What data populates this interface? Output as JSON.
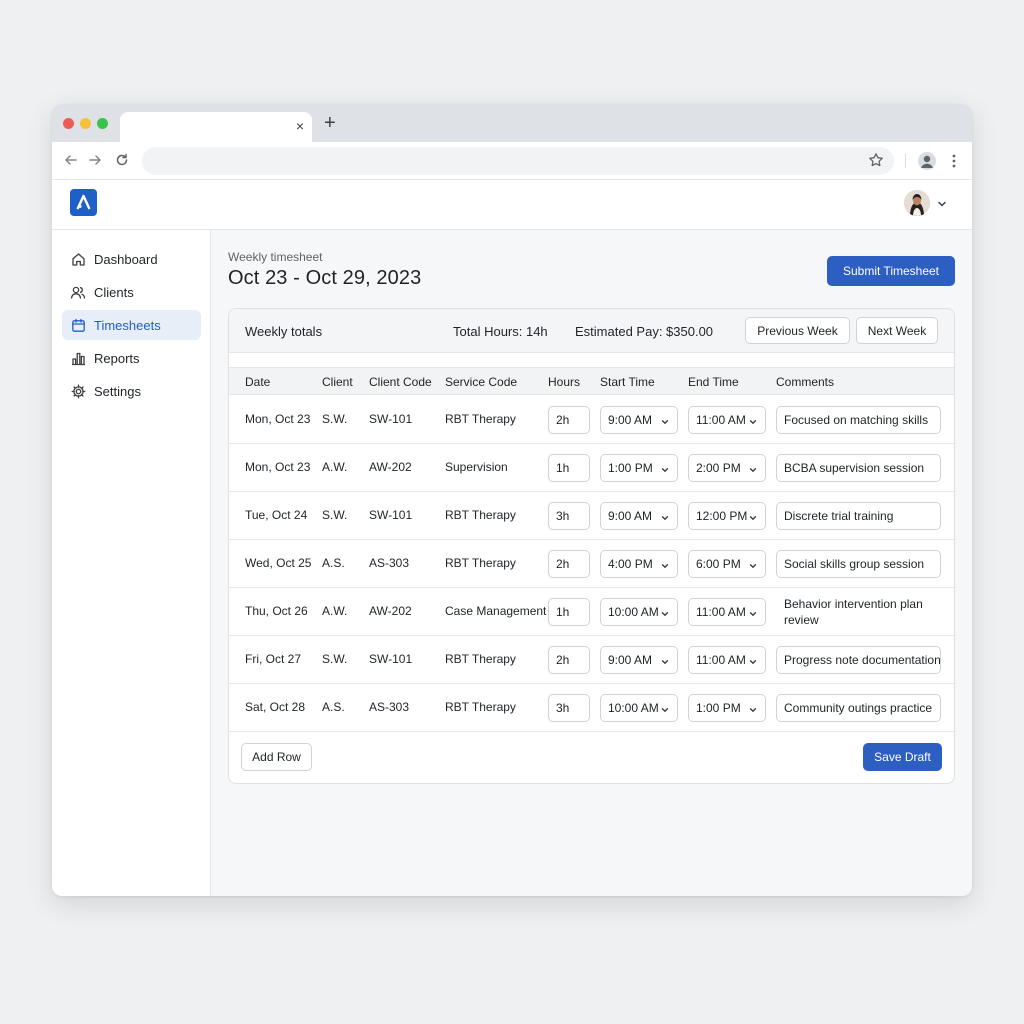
{
  "browser": {
    "tab_close": "×",
    "new_tab": "+"
  },
  "sidebar": {
    "items": [
      {
        "label": "Dashboard",
        "icon": "home-icon"
      },
      {
        "label": "Clients",
        "icon": "users-icon"
      },
      {
        "label": "Timesheets",
        "icon": "calendar-icon",
        "active": true
      },
      {
        "label": "Reports",
        "icon": "bar-chart-icon"
      },
      {
        "label": "Settings",
        "icon": "gear-icon"
      }
    ]
  },
  "page": {
    "subtitle": "Weekly timesheet",
    "title": "Oct 23 - Oct 29, 2023",
    "submit_label": "Submit Timesheet"
  },
  "totals": {
    "label": "Weekly totals",
    "total_hours": "Total Hours: 14h",
    "estimated_pay": "Estimated Pay: $350.00",
    "prev_label": "Previous Week",
    "next_label": "Next Week"
  },
  "table": {
    "headers": [
      "Date",
      "Client",
      "Client Code",
      "Service Code",
      "Hours",
      "Start Time",
      "End Time",
      "Comments"
    ],
    "rows": [
      {
        "date": "Mon, Oct 23",
        "client": "S.W.",
        "code": "SW-101",
        "service": "RBT Therapy",
        "hours": "2h",
        "start": "9:00 AM",
        "end": "11:00 AM",
        "comment": "Focused on matching skills"
      },
      {
        "date": "Mon, Oct 23",
        "client": "A.W.",
        "code": "AW-202",
        "service": "Supervision",
        "hours": "1h",
        "start": "1:00 PM",
        "end": "2:00 PM",
        "comment": "BCBA supervision session"
      },
      {
        "date": "Tue, Oct 24",
        "client": "S.W.",
        "code": "SW-101",
        "service": "RBT Therapy",
        "hours": "3h",
        "start": "9:00 AM",
        "end": "12:00 PM",
        "comment": "Discrete trial training"
      },
      {
        "date": "Wed, Oct 25",
        "client": "A.S.",
        "code": "AS-303",
        "service": "RBT Therapy",
        "hours": "2h",
        "start": "4:00 PM",
        "end": "6:00 PM",
        "comment": "Social skills group session"
      },
      {
        "date": "Thu, Oct 26",
        "client": "A.W.",
        "code": "AW-202",
        "service": "Case Management",
        "hours": "1h",
        "start": "10:00 AM",
        "end": "11:00 AM",
        "comment": "Behavior intervention plan review"
      },
      {
        "date": "Fri, Oct 27",
        "client": "S.W.",
        "code": "SW-101",
        "service": "RBT Therapy",
        "hours": "2h",
        "start": "9:00 AM",
        "end": "11:00 AM",
        "comment": "Progress note documentation"
      },
      {
        "date": "Sat, Oct 28",
        "client": "A.S.",
        "code": "AS-303",
        "service": "RBT Therapy",
        "hours": "3h",
        "start": "10:00 AM",
        "end": "1:00 PM",
        "comment": "Community outings practice"
      }
    ]
  },
  "actions": {
    "add_row_label": "Add Row",
    "save_draft_label": "Save Draft"
  },
  "colors": {
    "primary": "#2d5fc2",
    "logo": "#1f5fc8",
    "active_nav_bg": "#e8eef8"
  }
}
